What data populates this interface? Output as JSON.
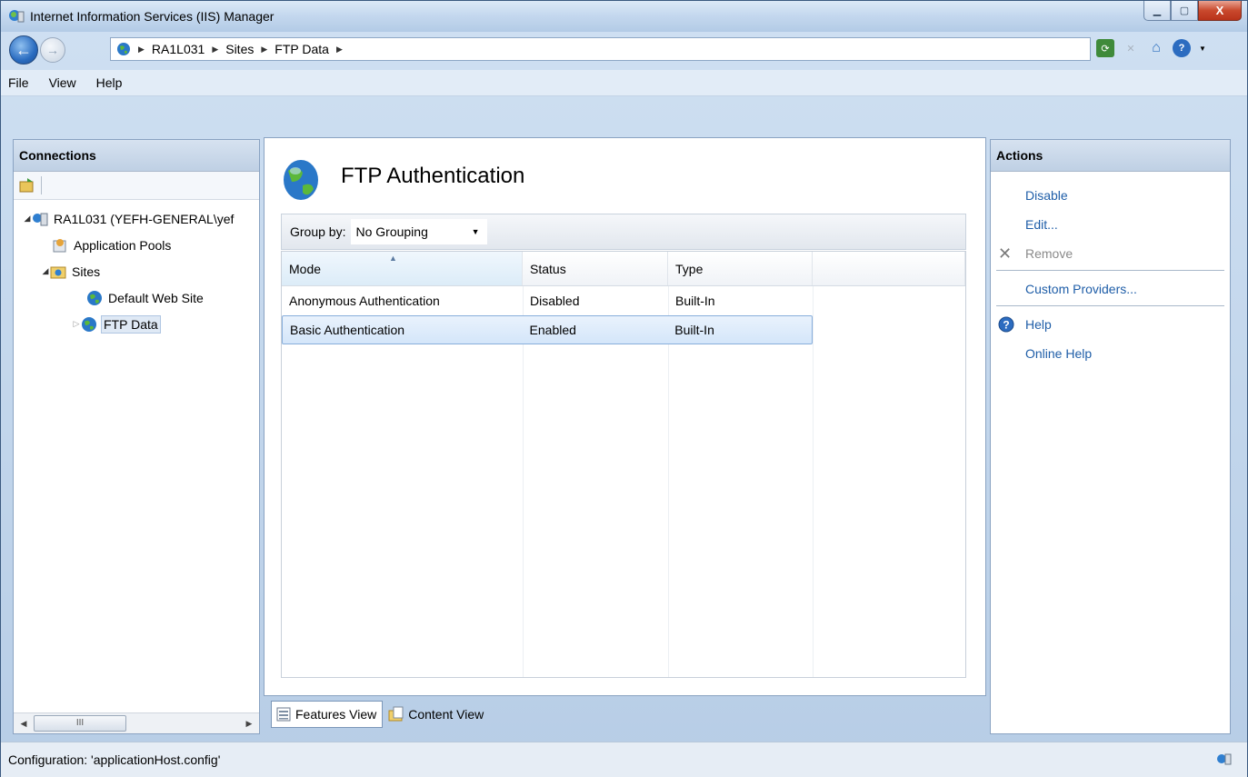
{
  "window": {
    "title": "Internet Information Services (IIS) Manager"
  },
  "address": {
    "crumbs": [
      "RA1L031",
      "Sites",
      "FTP Data"
    ]
  },
  "menu": {
    "file": "File",
    "view": "View",
    "help": "Help"
  },
  "connections": {
    "header": "Connections",
    "tree": [
      {
        "label": "RA1L031 (YEFH-GENERAL\\yef",
        "icon": "server-icon"
      },
      {
        "label": "Application Pools",
        "icon": "app-pools-icon"
      },
      {
        "label": "Sites",
        "icon": "sites-folder-icon"
      },
      {
        "label": "Default Web Site",
        "icon": "globe-icon"
      },
      {
        "label": "FTP Data",
        "icon": "globe-icon",
        "selected": true
      }
    ],
    "scroll_thumb": "III"
  },
  "feature": {
    "title": "FTP Authentication",
    "group_by_label": "Group by:",
    "group_by_value": "No Grouping",
    "columns": [
      "Mode",
      "Status",
      "Type"
    ],
    "rows": [
      {
        "mode": "Anonymous Authentication",
        "status": "Disabled",
        "type": "Built-In"
      },
      {
        "mode": "Basic Authentication",
        "status": "Enabled",
        "type": "Built-In",
        "selected": true
      }
    ]
  },
  "view_tabs": {
    "features": "Features View",
    "content": "Content View"
  },
  "actions": {
    "header": "Actions",
    "disable": "Disable",
    "edit": "Edit...",
    "remove": "Remove",
    "custom_providers": "Custom Providers...",
    "help": "Help",
    "online_help": "Online Help"
  },
  "status": {
    "text": "Configuration: 'applicationHost.config'"
  },
  "colors": {
    "link": "#1f5ea8",
    "selection": "#d4e6fa",
    "close_button": "#c9492d"
  }
}
